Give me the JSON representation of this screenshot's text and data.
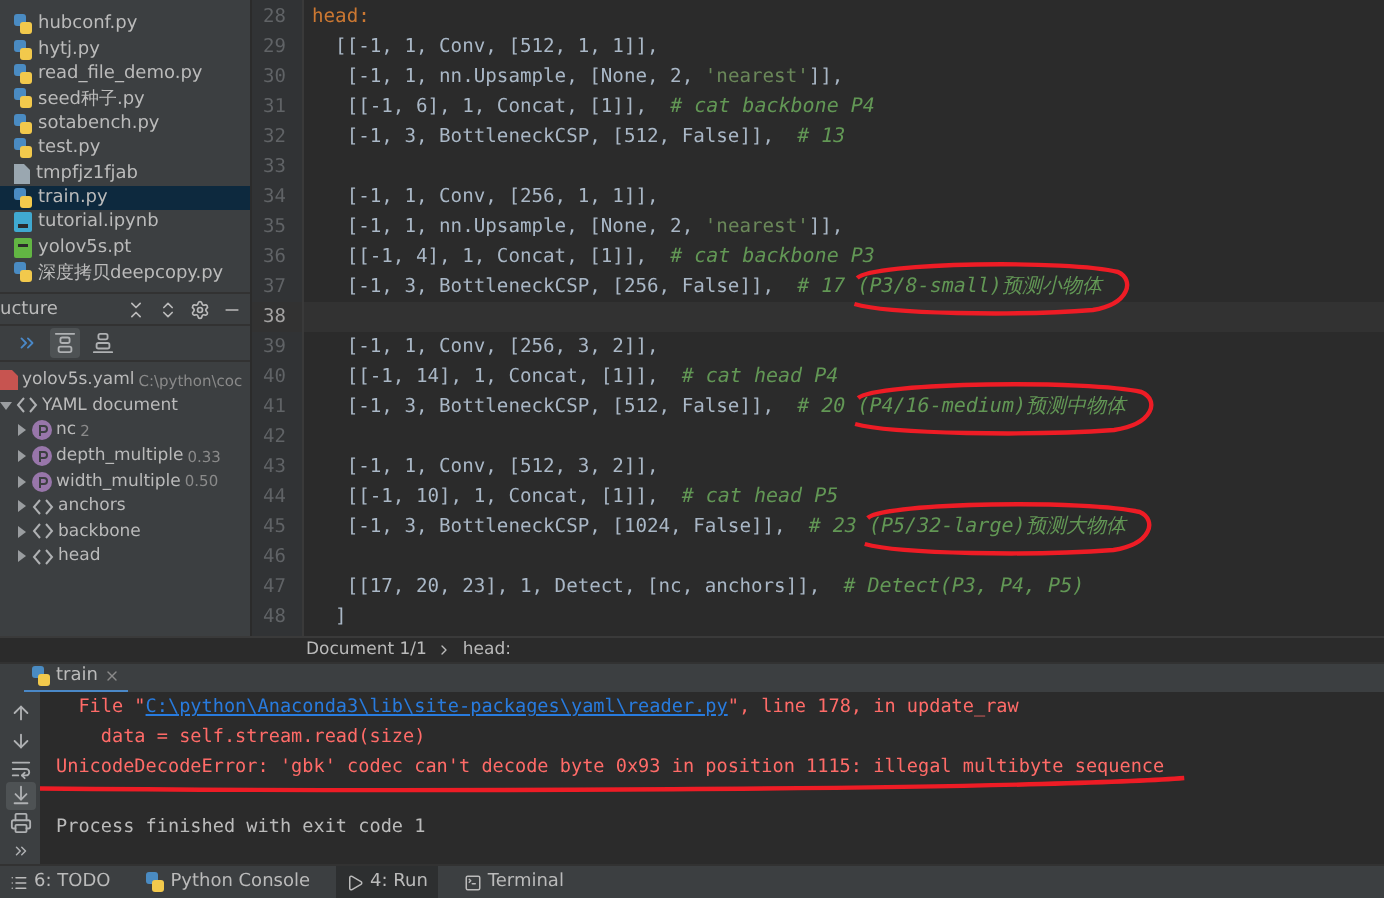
{
  "project": {
    "files": [
      {
        "name": "hubconf.py",
        "kind": "py",
        "selected": false
      },
      {
        "name": "hytj.py",
        "kind": "py",
        "selected": false
      },
      {
        "name": "read_file_demo.py",
        "kind": "py",
        "selected": false
      },
      {
        "name": "seed种子.py",
        "kind": "py",
        "selected": false
      },
      {
        "name": "sotabench.py",
        "kind": "py",
        "selected": false
      },
      {
        "name": "test.py",
        "kind": "py",
        "selected": false
      },
      {
        "name": "tmpfjz1fjab",
        "kind": "file",
        "selected": false
      },
      {
        "name": "train.py",
        "kind": "py",
        "selected": true
      },
      {
        "name": "tutorial.ipynb",
        "kind": "ipynb",
        "selected": false
      },
      {
        "name": "yolov5s.pt",
        "kind": "pt",
        "selected": false
      },
      {
        "name": "深度拷贝deepcopy.py",
        "kind": "py",
        "selected": false
      }
    ]
  },
  "structure": {
    "title": "ucture",
    "toolbar": [
      {
        "kind": "forward",
        "selected": false
      },
      {
        "kind": "align-top",
        "selected": true
      },
      {
        "kind": "align-bottom",
        "selected": false
      }
    ],
    "tree": [
      {
        "kind": "file",
        "name": "yolov5s.yaml",
        "value": "C:\\python\\coc",
        "children": [
          {
            "kind": "document",
            "name": "YAML document",
            "expanded": true,
            "children": [
              {
                "kind": "property",
                "name": "nc",
                "value": "2",
                "expanded": false
              },
              {
                "kind": "property",
                "name": "depth_multiple",
                "value": "0.33",
                "expanded": false
              },
              {
                "kind": "property",
                "name": "width_multiple",
                "value": "0.50",
                "expanded": false
              },
              {
                "kind": "section",
                "name": "anchors",
                "expanded": false
              },
              {
                "kind": "section",
                "name": "backbone",
                "expanded": false
              },
              {
                "kind": "section",
                "name": "head",
                "expanded": false
              }
            ]
          }
        ]
      }
    ]
  },
  "editor": {
    "lines": [
      {
        "number": "28",
        "current": false,
        "segments": [
          {
            "kind": "key",
            "text": "head:"
          }
        ]
      },
      {
        "number": "29",
        "current": false,
        "segments": [
          {
            "kind": "plain",
            "text": "  [[-1, 1, Conv, [512, 1, 1]],"
          }
        ]
      },
      {
        "number": "30",
        "current": false,
        "segments": [
          {
            "kind": "plain",
            "text": "   [-1, 1, nn.Upsample, [None, 2, "
          },
          {
            "kind": "string",
            "text": "'nearest'"
          },
          {
            "kind": "plain",
            "text": "]],"
          }
        ]
      },
      {
        "number": "31",
        "current": false,
        "segments": [
          {
            "kind": "plain",
            "text": "   [[-1, 6], 1, Concat, [1]],  "
          },
          {
            "kind": "comment",
            "text": "# cat backbone P4"
          }
        ]
      },
      {
        "number": "32",
        "current": false,
        "segments": [
          {
            "kind": "plain",
            "text": "   [-1, 3, BottleneckCSP, [512, False]],  "
          },
          {
            "kind": "comment",
            "text": "# 13"
          }
        ]
      },
      {
        "number": "33",
        "current": false
      },
      {
        "number": "34",
        "current": false,
        "segments": [
          {
            "kind": "plain",
            "text": "   [-1, 1, Conv, [256, 1, 1]],"
          }
        ]
      },
      {
        "number": "35",
        "current": false,
        "segments": [
          {
            "kind": "plain",
            "text": "   [-1, 1, nn.Upsample, [None, 2, "
          },
          {
            "kind": "string",
            "text": "'nearest'"
          },
          {
            "kind": "plain",
            "text": "]],"
          }
        ]
      },
      {
        "number": "36",
        "current": false,
        "segments": [
          {
            "kind": "plain",
            "text": "   [[-1, 4], 1, Concat, [1]],  "
          },
          {
            "kind": "comment",
            "text": "# cat backbone P3"
          }
        ]
      },
      {
        "number": "37",
        "current": false,
        "segments": [
          {
            "kind": "plain",
            "text": "   [-1, 3, BottleneckCSP, [256, False]],  "
          },
          {
            "kind": "comment",
            "text": "# 17 "
          },
          {
            "kind": "comment",
            "text": "(P3/8-small)预测小物体",
            "circled": true
          }
        ]
      },
      {
        "number": "38",
        "current": true
      },
      {
        "number": "39",
        "current": false,
        "segments": [
          {
            "kind": "plain",
            "text": "   [-1, 1, Conv, [256, 3, 2]],"
          }
        ]
      },
      {
        "number": "40",
        "current": false,
        "segments": [
          {
            "kind": "plain",
            "text": "   [[-1, 14], 1, Concat, [1]],  "
          },
          {
            "kind": "comment",
            "text": "# cat head P4"
          }
        ]
      },
      {
        "number": "41",
        "current": false,
        "segments": [
          {
            "kind": "plain",
            "text": "   [-1, 3, BottleneckCSP, [512, False]],  "
          },
          {
            "kind": "comment",
            "text": "# 20 "
          },
          {
            "kind": "comment",
            "text": "(P4/16-medium)预测中物体",
            "circled": true
          }
        ]
      },
      {
        "number": "42",
        "current": false
      },
      {
        "number": "43",
        "current": false,
        "segments": [
          {
            "kind": "plain",
            "text": "   [-1, 1, Conv, [512, 3, 2]],"
          }
        ]
      },
      {
        "number": "44",
        "current": false,
        "segments": [
          {
            "kind": "plain",
            "text": "   [[-1, 10], 1, Concat, [1]],  "
          },
          {
            "kind": "comment",
            "text": "# cat head P5"
          }
        ]
      },
      {
        "number": "45",
        "current": false,
        "segments": [
          {
            "kind": "plain",
            "text": "   [-1, 3, BottleneckCSP, [1024, False]],  "
          },
          {
            "kind": "comment",
            "text": "# 23 "
          },
          {
            "kind": "comment",
            "text": "(P5/32-large)预测大物体",
            "circled": true
          }
        ]
      },
      {
        "number": "46",
        "current": false
      },
      {
        "number": "47",
        "current": false,
        "segments": [
          {
            "kind": "plain",
            "text": "   [[17, 20, 23], 1, Detect, [nc, anchors]],  "
          },
          {
            "kind": "comment",
            "text": "# Detect(P3, P4, P5)"
          }
        ]
      },
      {
        "number": "48",
        "current": false,
        "segments": [
          {
            "kind": "plain",
            "text": "  ]"
          }
        ]
      }
    ]
  },
  "breadcrumb": [
    "Document 1/1",
    "head:"
  ],
  "run_tabs": [
    {
      "label": "train",
      "selected": true
    }
  ],
  "console": {
    "toolbar": [
      {
        "kind": "up",
        "selected": false
      },
      {
        "kind": "down",
        "selected": false
      },
      {
        "kind": "wrap",
        "selected": false
      },
      {
        "kind": "scroll-end",
        "selected": true
      },
      {
        "kind": "print",
        "selected": false
      },
      {
        "kind": "more",
        "selected": false
      }
    ],
    "lines": [
      {
        "kind": "trace",
        "segments": [
          {
            "kind": "plain",
            "text": "  File \""
          },
          {
            "kind": "link",
            "text": "C:\\python\\Anaconda3\\lib\\site-packages\\yaml\\reader.py"
          },
          {
            "kind": "plain",
            "text": "\", line 178, in update_raw"
          }
        ]
      },
      {
        "kind": "trace",
        "segments": [
          {
            "kind": "plain",
            "text": "    data = self.stream.read(size)"
          }
        ]
      },
      {
        "kind": "error",
        "underlined": true,
        "segments": [
          {
            "kind": "plain",
            "text": "UnicodeDecodeError: 'gbk' codec can't decode byte 0x93 in position 1115: illegal multibyte sequence"
          }
        ]
      },
      {
        "kind": "blank"
      },
      {
        "kind": "info",
        "segments": [
          {
            "kind": "plain",
            "text": "Process finished with exit code 1"
          }
        ]
      }
    ]
  },
  "bottom_tabs": [
    {
      "label": "6: TODO",
      "kind": "todo",
      "selected": false
    },
    {
      "label": "Python Console",
      "kind": "python",
      "selected": false
    },
    {
      "label": "4: Run",
      "kind": "run",
      "selected": true
    },
    {
      "label": "Terminal",
      "kind": "terminal",
      "selected": false
    }
  ]
}
